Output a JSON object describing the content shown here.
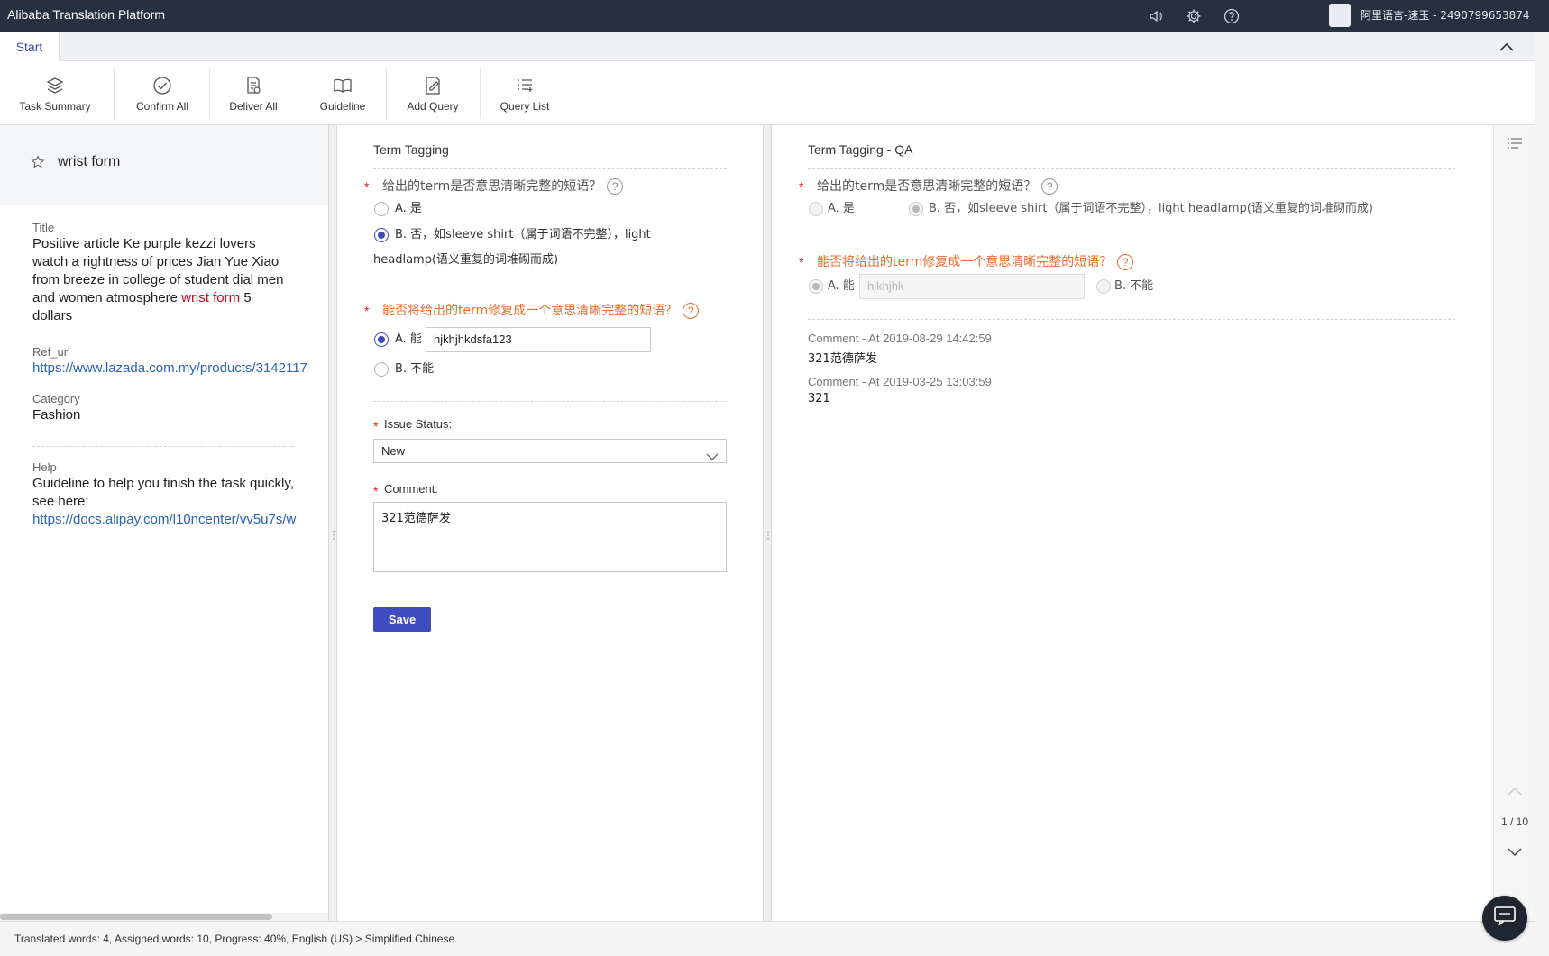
{
  "app": {
    "title": "Alibaba Translation Platform",
    "user": "阿里语言-速玉 - 2490799653874"
  },
  "tabs": {
    "start": "Start"
  },
  "toolbar": {
    "task_summary": "Task Summary",
    "confirm_all": "Confirm All",
    "deliver_all": "Deliver All",
    "guideline": "Guideline",
    "add_query": "Add Query",
    "query_list": "Query List"
  },
  "left": {
    "term": "wrist form",
    "title_label": "Title",
    "title_text": "Positive article Ke purple kezzi lovers watch a rightness of prices Jian Yue Xiao from breeze in college of student dial men and women atmosphere",
    "title_highlight": "wrist form",
    "title_suffix": "5 dollars",
    "ref_url_label": "Ref_url",
    "ref_url": "https://www.lazada.com.my/products/3142117",
    "category_label": "Category",
    "category": "Fashion",
    "help_label": "Help",
    "help_text": "Guideline to help you finish the task quickly, see here:",
    "help_url": "https://docs.alipay.com/l10ncenter/vv5u7s/w"
  },
  "mid": {
    "section_title": "Term Tagging",
    "q1": "给出的term是否意思清晰完整的短语？",
    "q1_a": "A. 是",
    "q1_b_line1": "B. 否，如sleeve shirt（属于词语不完整），light",
    "q1_b_line2": "headlamp(语义重复的词堆砌而成)",
    "q2": "能否将给出的term修复成一个意思清晰完整的短语？",
    "q2_a": "A. 能",
    "q2_a_value": "hjkhjhkdsfa123",
    "q2_b": "B. 不能",
    "issue_status_label": "Issue Status:",
    "issue_status_value": "New",
    "comment_label": "Comment:",
    "comment_value": "321范德萨发",
    "save": "Save"
  },
  "right": {
    "section_title": "Term Tagging - QA",
    "q1": "给出的term是否意思清晰完整的短语？",
    "q1_a": "A. 是",
    "q1_b": "B. 否，如sleeve shirt（属于词语不完整），light headlamp(语义重复的词堆砌而成)",
    "q2": "能否将给出的term修复成一个意思清晰完整的短语？",
    "q2_a": "A. 能",
    "q2_a_value": "hjkhjhk",
    "q2_b": "B. 不能",
    "comments": [
      {
        "meta": "Comment - At 2019-08-29 14:42:59",
        "text": "321范德萨发"
      },
      {
        "meta": "Comment - At 2019-03-25 13:03:59",
        "text": "321"
      }
    ]
  },
  "pager": "1 / 10",
  "status": "Translated words: 4, Assigned words: 10, Progress: 40%, English (US) > Simplified Chinese",
  "colors": {
    "topbar": "#26303e",
    "primary": "#3f4dc0",
    "warning": "#f06a2a",
    "highlight": "#d0021b",
    "link": "#2a63b8"
  }
}
